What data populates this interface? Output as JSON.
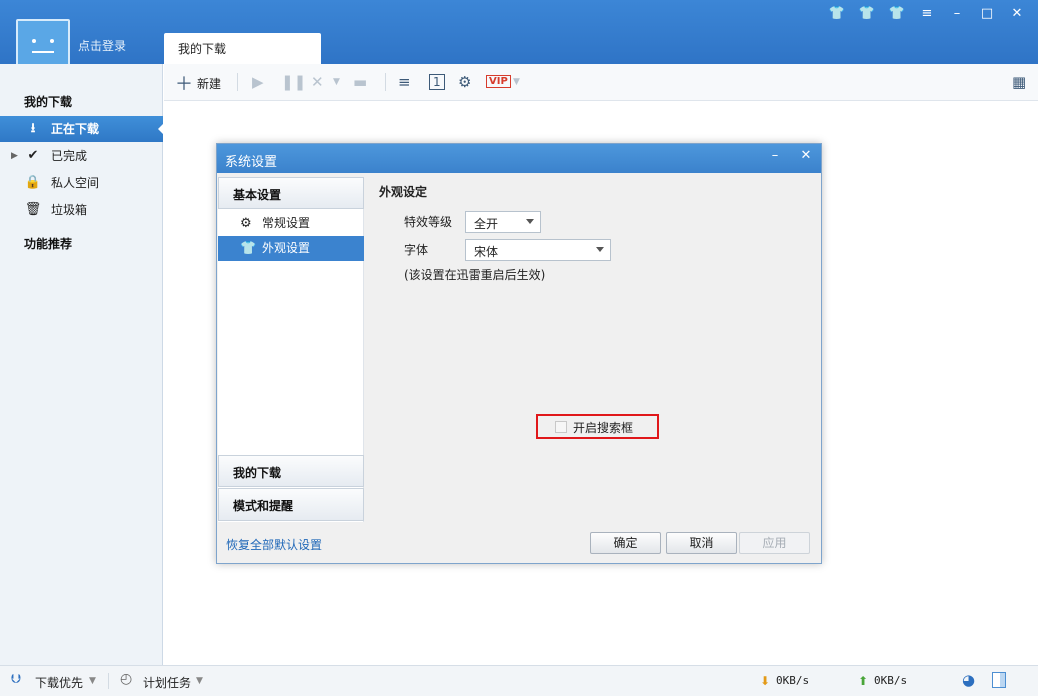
{
  "header": {
    "login_label": "点击登录",
    "tab_label": "我的下载",
    "window_buttons": [
      "shirt-icon",
      "shirt-icon",
      "shirt-icon",
      "menu-icon",
      "minimize-icon",
      "maximize-icon",
      "close-icon"
    ]
  },
  "sidebar": {
    "section1": "我的下载",
    "items": [
      {
        "label": "正在下载",
        "icon": "download-icon",
        "active": true
      },
      {
        "label": "已完成",
        "icon": "check-icon"
      },
      {
        "label": "私人空间",
        "icon": "lock-icon"
      },
      {
        "label": "垃圾箱",
        "icon": "trash-icon"
      }
    ],
    "section2": "功能推荐"
  },
  "toolbar": {
    "new_label": "新建"
  },
  "dialog": {
    "title": "系统设置",
    "groups": {
      "basic": "基本设置",
      "my_download": "我的下载",
      "mode_reminder": "模式和提醒"
    },
    "sub_items": [
      {
        "label": "常规设置",
        "icon": "gear-icon"
      },
      {
        "label": "外观设置",
        "icon": "shirt-icon",
        "active": true
      }
    ],
    "section_title": "外观设定",
    "effect_label": "特效等级",
    "effect_value": "全开",
    "font_label": "字体",
    "font_value": "宋体",
    "note": "(该设置在迅雷重启后生效)",
    "checkbox_label": "开启搜索框",
    "checkbox_checked": false,
    "reset_label": "恢复全部默认设置",
    "ok_label": "确定",
    "cancel_label": "取消",
    "apply_label": "应用"
  },
  "status": {
    "priority_label": "下载优先",
    "schedule_label": "计划任务",
    "down_speed": "0KB/s",
    "up_speed": "0KB/s"
  }
}
